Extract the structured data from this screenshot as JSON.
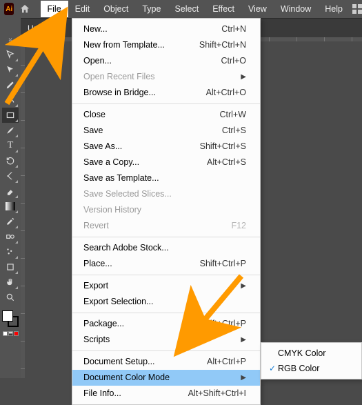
{
  "app": {
    "logo_text": "Ai"
  },
  "menubar": {
    "items": [
      "File",
      "Edit",
      "Object",
      "Type",
      "Select",
      "Effect",
      "View",
      "Window",
      "Help"
    ],
    "open_index": 0
  },
  "tab": {
    "label": "Un"
  },
  "file_menu": {
    "groups": [
      [
        {
          "label": "New...",
          "shortcut": "Ctrl+N"
        },
        {
          "label": "New from Template...",
          "shortcut": "Shift+Ctrl+N"
        },
        {
          "label": "Open...",
          "shortcut": "Ctrl+O"
        },
        {
          "label": "Open Recent Files",
          "sub": true,
          "disabled": true
        },
        {
          "label": "Browse in Bridge...",
          "shortcut": "Alt+Ctrl+O"
        }
      ],
      [
        {
          "label": "Close",
          "shortcut": "Ctrl+W"
        },
        {
          "label": "Save",
          "shortcut": "Ctrl+S"
        },
        {
          "label": "Save As...",
          "shortcut": "Shift+Ctrl+S"
        },
        {
          "label": "Save a Copy...",
          "shortcut": "Alt+Ctrl+S"
        },
        {
          "label": "Save as Template..."
        },
        {
          "label": "Save Selected Slices...",
          "disabled": true
        },
        {
          "label": "Version History",
          "disabled": true
        },
        {
          "label": "Revert",
          "shortcut": "F12",
          "disabled": true
        }
      ],
      [
        {
          "label": "Search Adobe Stock..."
        },
        {
          "label": "Place...",
          "shortcut": "Shift+Ctrl+P"
        }
      ],
      [
        {
          "label": "Export",
          "sub": true
        },
        {
          "label": "Export Selection..."
        }
      ],
      [
        {
          "label": "Package...",
          "shortcut": "Alt+Shift+Ctrl+P"
        },
        {
          "label": "Scripts",
          "sub": true
        }
      ],
      [
        {
          "label": "Document Setup...",
          "shortcut": "Alt+Ctrl+P"
        },
        {
          "label": "Document Color Mode",
          "sub": true,
          "highlight": true
        },
        {
          "label": "File Info...",
          "shortcut": "Alt+Shift+Ctrl+I"
        }
      ]
    ]
  },
  "color_mode_submenu": {
    "items": [
      {
        "label": "CMYK Color",
        "checked": false
      },
      {
        "label": "RGB Color",
        "checked": true
      }
    ]
  },
  "tools": [
    "selection",
    "direct-selection",
    "pen",
    "curvature",
    "rectangle",
    "paintbrush",
    "type",
    "rotate",
    "scissors",
    "eraser",
    "gradient",
    "eyedropper",
    "blend",
    "symbol-sprayer",
    "artboard",
    "hand",
    "zoom"
  ]
}
